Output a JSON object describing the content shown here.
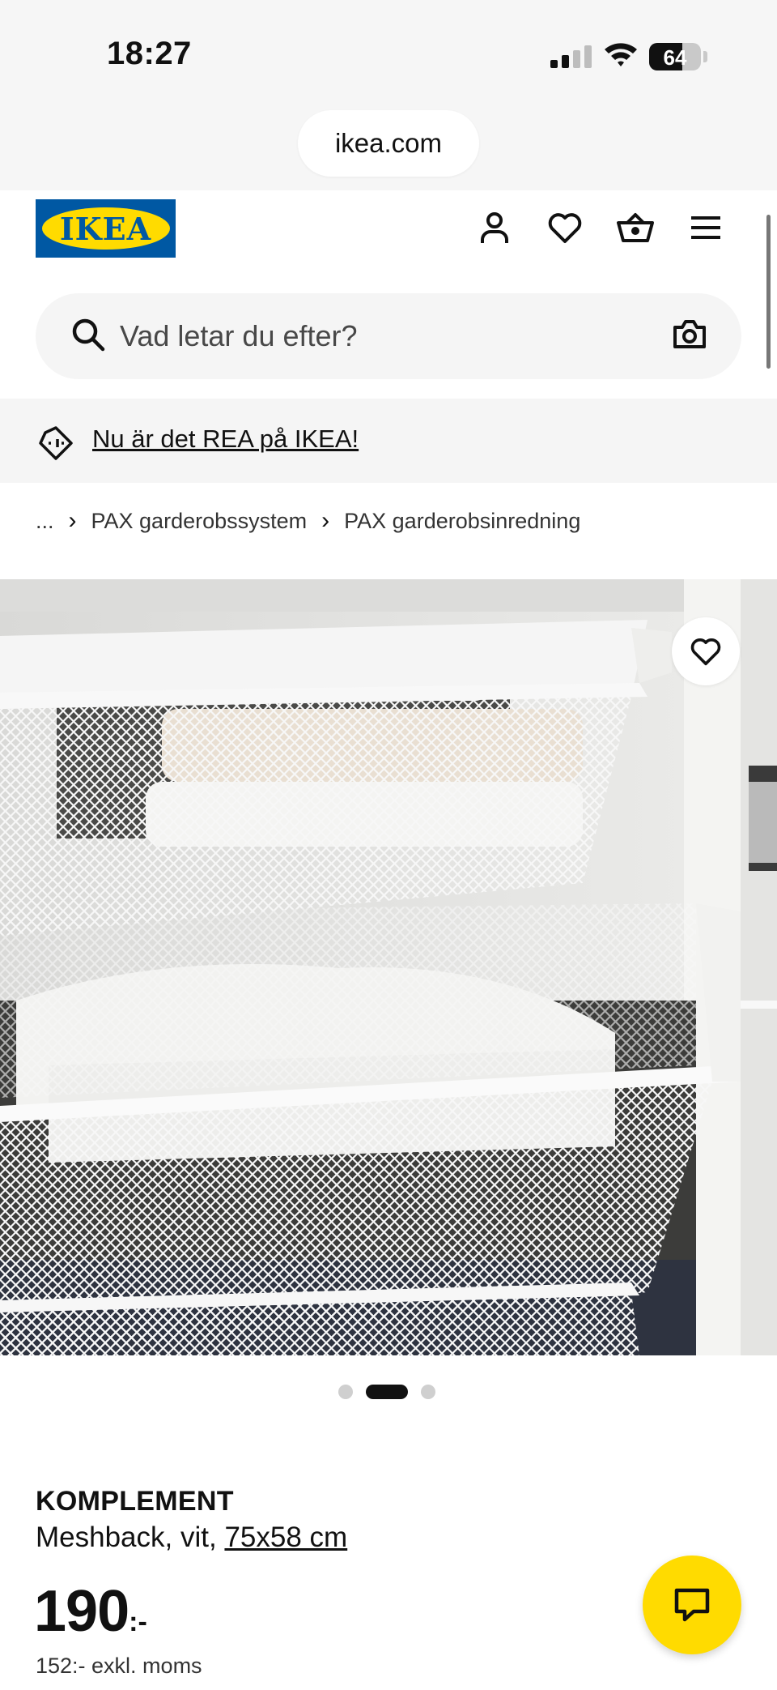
{
  "status_bar": {
    "time": "18:27",
    "battery_percent": "64",
    "battery_level": 0.64
  },
  "browser": {
    "url": "ikea.com"
  },
  "header": {
    "logo_text": "IKEA",
    "brand_colors": {
      "blue": "#0058a3",
      "yellow": "#ffdb00"
    },
    "icons": [
      "profile-icon",
      "heart-icon",
      "basket-icon",
      "menu-icon"
    ]
  },
  "search": {
    "placeholder": "Vad letar du efter?"
  },
  "promo": {
    "text": "Nu är det REA på IKEA!"
  },
  "breadcrumb": {
    "items": [
      "...",
      "PAX garderobssystem",
      "PAX garderobsinredning"
    ]
  },
  "carousel": {
    "count": 3,
    "active_index": 1
  },
  "product": {
    "name": "KOMPLEMENT",
    "description": "Meshback, vit,",
    "size": "75x58 cm",
    "price": "190",
    "price_suffix": ":-",
    "price_excl_vat": "152:- exkl. moms"
  }
}
